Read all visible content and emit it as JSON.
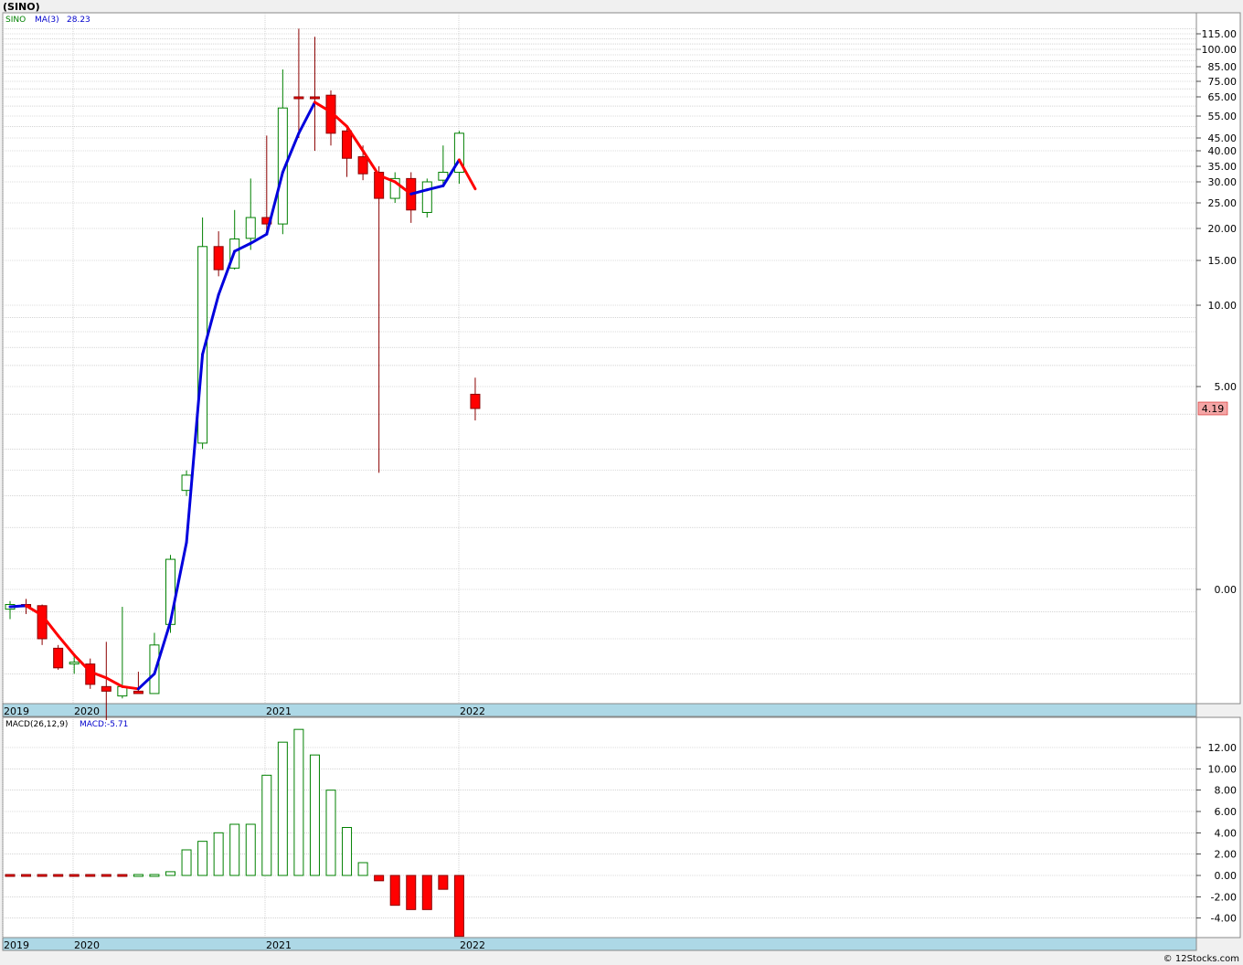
{
  "header": {
    "symbol": "(SINO)",
    "copyright": "© 12Stocks.com"
  },
  "colors": {
    "up": "#008000",
    "down": "#ff0000",
    "ma_rising": "#0000dd",
    "ma_falling": "#ff0000",
    "axis_band": "#add8e6"
  },
  "chart_data": [
    {
      "type": "candlestick",
      "name": "price",
      "legend": {
        "symbol": "SINO",
        "ma_label": "MA(3)",
        "ma_value": "28.23"
      },
      "last_price_label": "4.19",
      "ytick_labels": [
        "115.00",
        "100.00",
        "85.00",
        "75.00",
        "65.00",
        "55.00",
        "45.00",
        "40.00",
        "35.00",
        "30.00",
        "25.00",
        "20.00",
        "15.00",
        "10.00",
        "5.00",
        "0.00"
      ],
      "x_labels": [
        "2019",
        "2020",
        "2021",
        "2022"
      ],
      "candles": [
        {
          "o": 0.62,
          "h": 0.69,
          "l": 0.54,
          "c": 0.66
        },
        {
          "o": 0.66,
          "h": 0.71,
          "l": 0.58,
          "c": 0.64
        },
        {
          "o": 0.65,
          "h": 0.66,
          "l": 0.36,
          "c": 0.4
        },
        {
          "o": 0.34,
          "h": 0.36,
          "l": 0.22,
          "c": 0.23
        },
        {
          "o": 0.26,
          "h": 0.3,
          "l": 0.2,
          "c": 0.26
        },
        {
          "o": 0.25,
          "h": 0.28,
          "l": 0.13,
          "c": 0.15
        },
        {
          "o": 0.14,
          "h": 0.38,
          "l": 0.01,
          "c": 0.12
        },
        {
          "o": 0.1,
          "h": 0.64,
          "l": 0.09,
          "c": 0.14
        },
        {
          "o": 0.12,
          "h": 0.21,
          "l": 0.11,
          "c": 0.11
        },
        {
          "o": 0.11,
          "h": 0.44,
          "l": 0.11,
          "c": 0.36
        },
        {
          "o": 0.5,
          "h": 1.15,
          "l": 0.44,
          "c": 1.1
        },
        {
          "o": 2.1,
          "h": 2.5,
          "l": 2.0,
          "c": 2.4
        },
        {
          "o": 3.15,
          "h": 22.0,
          "l": 3.0,
          "c": 17.0
        },
        {
          "o": 17.0,
          "h": 19.5,
          "l": 13.0,
          "c": 13.8
        },
        {
          "o": 14.0,
          "h": 23.5,
          "l": 13.8,
          "c": 18.2
        },
        {
          "o": 18.3,
          "h": 31.0,
          "l": 16.5,
          "c": 22.0
        },
        {
          "o": 22.0,
          "h": 46.0,
          "l": 19.0,
          "c": 20.8
        },
        {
          "o": 20.8,
          "h": 83.0,
          "l": 19.0,
          "c": 59.0
        },
        {
          "o": 65.0,
          "h": 120.0,
          "l": 45.0,
          "c": 64.0
        },
        {
          "o": 65.0,
          "h": 112.0,
          "l": 40.0,
          "c": 64.0
        },
        {
          "o": 66.0,
          "h": 69.0,
          "l": 42.0,
          "c": 47.0
        },
        {
          "o": 48.0,
          "h": 49.5,
          "l": 31.5,
          "c": 37.5
        },
        {
          "o": 38.0,
          "h": 42.0,
          "l": 30.5,
          "c": 32.5
        },
        {
          "o": 33.0,
          "h": 35.0,
          "l": 2.45,
          "c": 26.0
        },
        {
          "o": 26.0,
          "h": 33.0,
          "l": 25.0,
          "c": 31.0
        },
        {
          "o": 31.0,
          "h": 33.0,
          "l": 21.0,
          "c": 23.5
        },
        {
          "o": 23.0,
          "h": 31.0,
          "l": 22.0,
          "c": 30.0
        },
        {
          "o": 30.5,
          "h": 42.0,
          "l": 29.0,
          "c": 33.0
        },
        {
          "o": 33.0,
          "h": 48.0,
          "l": 29.5,
          "c": 47.0
        },
        {
          "o": 4.7,
          "h": 5.4,
          "l": 3.8,
          "c": 4.19
        }
      ],
      "ma3": [
        0.64,
        0.65,
        0.57,
        0.42,
        0.3,
        0.21,
        0.18,
        0.14,
        0.13,
        0.2,
        0.52,
        1.3,
        6.6,
        11.0,
        16.3,
        17.5,
        19.0,
        33.0,
        47.0,
        62.0,
        57.0,
        50.0,
        40.0,
        32.0,
        30.0,
        27.0,
        28.0,
        29.0,
        37.0,
        28.23
      ]
    },
    {
      "type": "bar",
      "name": "macd",
      "legend": {
        "label": "MACD(26,12,9)",
        "value_label": "MACD:-5.71"
      },
      "ylim": [
        -5.0,
        14.0
      ],
      "ytick_labels": [
        "12.00",
        "10.00",
        "8.00",
        "6.00",
        "4.00",
        "2.00",
        "0.00",
        "-2.00",
        "-4.00"
      ],
      "x_labels": [
        "2019",
        "2020",
        "2021",
        "2022"
      ],
      "values": [
        -0.01,
        -0.02,
        -0.04,
        -0.06,
        -0.08,
        -0.1,
        -0.09,
        -0.05,
        0.05,
        0.1,
        0.35,
        2.4,
        3.2,
        4.0,
        4.8,
        4.8,
        9.4,
        12.5,
        13.7,
        11.3,
        8.0,
        4.5,
        1.2,
        -0.5,
        -2.8,
        -3.2,
        -3.2,
        -1.3,
        -5.71
      ]
    }
  ]
}
